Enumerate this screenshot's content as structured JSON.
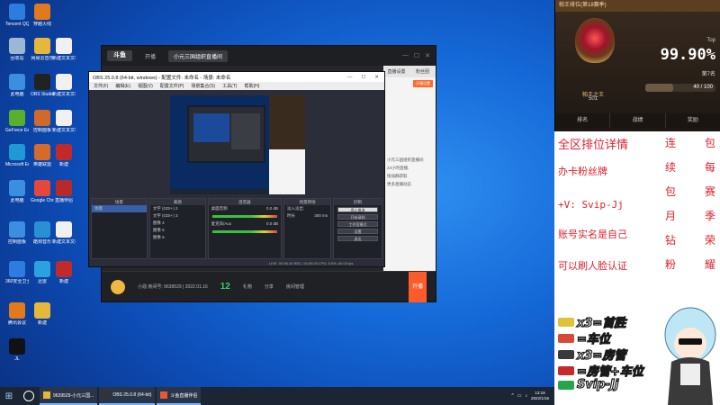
{
  "desktop": {
    "icons": [
      {
        "label": "Tencent QQ",
        "color": "#2d7de0"
      },
      {
        "label": "穿越火线",
        "color": "#e07a1c"
      },
      {
        "label": "回收站",
        "color": "#9ab7d6"
      },
      {
        "label": "网易云音乐",
        "color": "#e5b83c"
      },
      {
        "label": "新建文本文档",
        "color": "#f0f0f0"
      },
      {
        "label": "此电脑",
        "color": "#3b8ee0"
      },
      {
        "label": "OBS Studio",
        "color": "#222"
      },
      {
        "label": "新建文本文档",
        "color": "#f0f0f0"
      },
      {
        "label": "GeForce Experience",
        "color": "#5ab02c"
      },
      {
        "label": "控制面板",
        "color": "#d06a2a"
      },
      {
        "label": "新建文本文档",
        "color": "#f0f0f0"
      },
      {
        "label": "Microsoft Edge",
        "color": "#1d9ad6"
      },
      {
        "label": "英雄联盟",
        "color": "#d66a2a"
      },
      {
        "label": "新建",
        "color": "#c02a2a"
      },
      {
        "label": "此电脑",
        "color": "#3b8ee0"
      },
      {
        "label": "Google Chrome",
        "color": "#e5483a"
      },
      {
        "label": "直播伴侣",
        "color": "#b82a2a"
      },
      {
        "label": "控制面板",
        "color": "#3b8ee0"
      },
      {
        "label": "酷狗音乐",
        "color": "#2a90d6"
      },
      {
        "label": "新建文本文档",
        "color": "#f0f0f0"
      },
      {
        "label": "360安全卫士",
        "color": "#2d7de0"
      },
      {
        "label": "迅雷",
        "color": "#2aa2e0"
      },
      {
        "label": "新建",
        "color": "#c02a2a"
      },
      {
        "label": "腾讯会议",
        "color": "#e07a1c"
      },
      {
        "label": "新建",
        "color": "#e5b83c"
      },
      {
        "label": "JL",
        "color": "#111"
      }
    ]
  },
  "live_app": {
    "logo": "斗鱼",
    "tabs": [
      "开播",
      "小元三国组织直播间",
      "直播伴侣"
    ],
    "side_tabs": [
      "直播设置",
      "粉丝团"
    ],
    "side_orange": "开播设置",
    "side_text": [
      "小元三国组织直播间",
      "24小时直播,",
      "快加群获取",
      "更多直播动态"
    ],
    "bottom": {
      "id_label": "小勋 房间号: 9639529 | 2022.01.16",
      "count": "12",
      "items": [
        "礼物",
        "分享",
        "房间管理",
        "连麦",
        "PK",
        "更多"
      ],
      "start_label": "开播"
    }
  },
  "obs": {
    "title": "OBS 25.0.8 (64-bit, windows) - 配置文件: 未命名 - 场景: 未命名",
    "menu": [
      "文件(F)",
      "编辑(E)",
      "视图(V)",
      "配置文件(P)",
      "场景集合(S)",
      "工具(T)",
      "帮助(H)"
    ],
    "docks": {
      "scenes": {
        "title": "场景",
        "items": [
          "场景"
        ]
      },
      "sources": {
        "title": "来源",
        "items": [
          "文字 (GDI+) 2",
          "文字 (GDI+) 3",
          "图像 4",
          "图像 5",
          "图像 6"
        ]
      },
      "mixer": {
        "title": "混音器",
        "tracks": [
          "桌面音频",
          "麦克风/Aux"
        ],
        "db": "0.0 dB"
      },
      "transitions": {
        "title": "场景转场",
        "type": "淡入淡出",
        "duration_label": "时长",
        "duration": "300 ms"
      },
      "controls": {
        "title": "控制",
        "buttons": [
          "停止推流",
          "开始录制",
          "工作室模式",
          "设置",
          "退出"
        ]
      }
    },
    "status": "LIVE: 00:56:18   REC: 00:00:00   CPU: 5.5%, 60.00 fps"
  },
  "taskbar": {
    "apps": [
      "9639529-小元三国...",
      "OBS 25.0.8 (64-bit)",
      "斗鱼直播伴侣"
    ],
    "time": "13:19",
    "date": "2022/1/16"
  },
  "overlay": {
    "rank": {
      "header": "帕王排位(第18赛季)",
      "title": "帕王之王",
      "score": "501",
      "top_label": "Top",
      "percent": "99.90%",
      "position": "第7名",
      "progress_text": "40 / 100",
      "progress_fraction": 0.4,
      "tabs": [
        "排名",
        "战绩",
        "奖励"
      ]
    },
    "promo": {
      "lines": [
        "全区排位详情",
        "办卡粉丝牌",
        "+V: Svip-Jj",
        "账号实名是自己",
        "可以刷人脸认证"
      ],
      "col1": [
        "连",
        "续",
        "包",
        "月",
        "钻",
        "粉"
      ],
      "col2": [
        "包",
        "每",
        "赛",
        "季",
        "荣",
        "耀"
      ]
    },
    "gifts": [
      {
        "text": "x3=首胜",
        "color": "#e0c23a"
      },
      {
        "text": "=车位",
        "color": "#d64a3a"
      },
      {
        "text": "x3=房管",
        "color": "#3a3a3a"
      },
      {
        "text": "=房管+车位",
        "color": "#c52a2a"
      },
      {
        "text": "Svip-Jj",
        "color": "#2aa44a"
      }
    ]
  }
}
